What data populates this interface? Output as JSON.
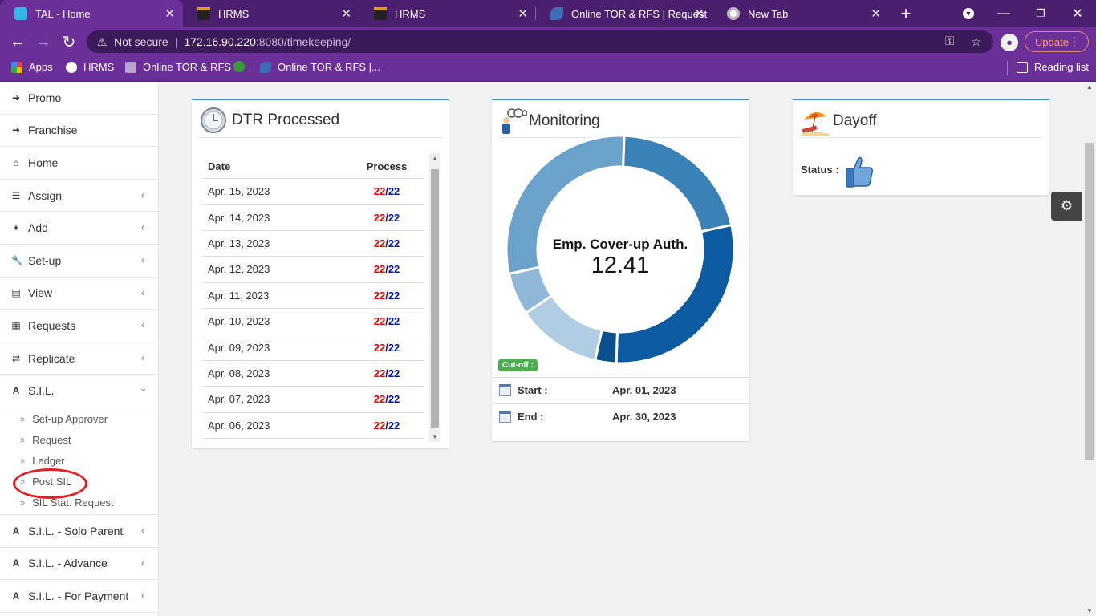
{
  "browser": {
    "tabs": [
      {
        "title": "TAL - Home",
        "active": true
      },
      {
        "title": "HRMS",
        "active": false
      },
      {
        "title": "HRMS",
        "active": false
      },
      {
        "title": "Online TOR & RFS | Request",
        "active": false
      },
      {
        "title": "New Tab",
        "active": false
      }
    ],
    "security_label": "Not secure",
    "url_host": "172.16.90.220",
    "url_path": ":8080/timekeeping/",
    "update_label": "Update",
    "bookmarks": [
      "Apps",
      "HRMS",
      "Online TOR & RFS",
      "",
      "Online TOR & RFS |..."
    ],
    "reading_list": "Reading list"
  },
  "sidebar": {
    "items": [
      {
        "label": "Promo",
        "icon": "arrow-right-icon"
      },
      {
        "label": "Franchise",
        "icon": "arrow-right-icon"
      },
      {
        "label": "Home",
        "icon": "home-icon"
      },
      {
        "label": "Assign",
        "icon": "list-icon"
      },
      {
        "label": "Add",
        "icon": "plus-icon"
      },
      {
        "label": "Set-up",
        "icon": "wrench-icon"
      },
      {
        "label": "View",
        "icon": "window-icon"
      },
      {
        "label": "Requests",
        "icon": "file-icon"
      },
      {
        "label": "Replicate",
        "icon": "exchange-icon"
      },
      {
        "label": "S.I.L.",
        "icon": "road-icon"
      }
    ],
    "sil_sub": [
      "Set-up Approver",
      "Request",
      "Ledger",
      "Post SIL",
      "SIL Stat. Request"
    ],
    "bottom_items": [
      {
        "label": "S.I.L. - Solo Parent",
        "icon": "road-icon"
      },
      {
        "label": "S.I.L. - Advance",
        "icon": "road-icon"
      },
      {
        "label": "S.I.L. - For Payment",
        "icon": "road-icon"
      }
    ]
  },
  "dtr": {
    "title": "DTR Processed",
    "col_date": "Date",
    "col_process": "Process",
    "rows": [
      {
        "date": "Apr. 15, 2023",
        "done": "22",
        "slash": "/",
        "total": "22"
      },
      {
        "date": "Apr. 14, 2023",
        "done": "22",
        "slash": "/",
        "total": "22"
      },
      {
        "date": "Apr. 13, 2023",
        "done": "22",
        "slash": "/",
        "total": "22"
      },
      {
        "date": "Apr. 12, 2023",
        "done": "22",
        "slash": "/",
        "total": "22"
      },
      {
        "date": "Apr. 11, 2023",
        "done": "22",
        "slash": "/",
        "total": "22"
      },
      {
        "date": "Apr. 10, 2023",
        "done": "22",
        "slash": "/",
        "total": "22"
      },
      {
        "date": "Apr. 09, 2023",
        "done": "22",
        "slash": "/",
        "total": "22"
      },
      {
        "date": "Apr. 08, 2023",
        "done": "22",
        "slash": "/",
        "total": "22"
      },
      {
        "date": "Apr. 07, 2023",
        "done": "22",
        "slash": "/",
        "total": "22"
      },
      {
        "date": "Apr. 06, 2023",
        "done": "22",
        "slash": "/",
        "total": "22"
      }
    ]
  },
  "monitoring": {
    "title": "Monitoring",
    "center_label": "Emp. Cover-up Auth.",
    "center_value": "12.41",
    "segments": [
      {
        "value": 21,
        "color": "#3a81b8"
      },
      {
        "value": 29,
        "color": "#0c5aa0"
      },
      {
        "value": 3,
        "color": "#0b4f8f"
      },
      {
        "value": 12,
        "color": "#b1cde3"
      },
      {
        "value": 6,
        "color": "#8fb8d8"
      },
      {
        "value": 29,
        "color": "#6aa2cc"
      }
    ],
    "cutoff_label": "Cut-off :",
    "start_label": "Start :",
    "start_value": "Apr. 01, 2023",
    "end_label": "End :",
    "end_value": "Apr. 30, 2023"
  },
  "dayoff": {
    "title": "Dayoff",
    "status_label": "Status :"
  }
}
